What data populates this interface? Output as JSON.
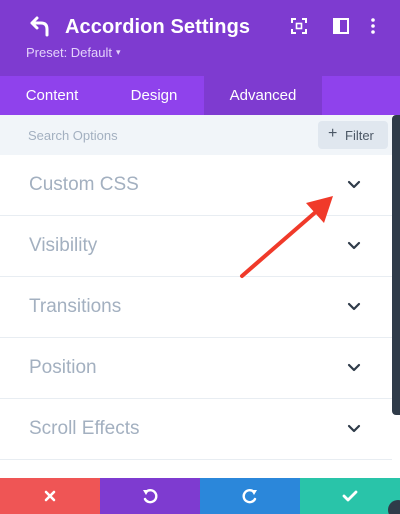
{
  "header": {
    "title": "Accordion Settings",
    "preset_label": "Preset: Default",
    "preset_caret": "▾",
    "icons": [
      "back-icon",
      "expand-icon",
      "sidebar-toggle-icon",
      "more-options-icon"
    ]
  },
  "tabs": [
    {
      "label": "Content",
      "active": false
    },
    {
      "label": "Design",
      "active": false
    },
    {
      "label": "Advanced",
      "active": true
    }
  ],
  "search": {
    "placeholder": "Search Options",
    "value": "",
    "filter_label": "Filter",
    "filter_icon": "plus-icon"
  },
  "sections": [
    {
      "label": "Custom CSS",
      "icon": "chevron-down-icon"
    },
    {
      "label": "Visibility",
      "icon": "chevron-down-icon"
    },
    {
      "label": "Transitions",
      "icon": "chevron-down-icon"
    },
    {
      "label": "Position",
      "icon": "chevron-down-icon"
    },
    {
      "label": "Scroll Effects",
      "icon": "chevron-down-icon"
    }
  ],
  "annotation": {
    "icon": "red-arrow",
    "color": "#f03a2a"
  },
  "footer": {
    "buttons": [
      {
        "icon": "close-icon",
        "color": "#ef5555"
      },
      {
        "icon": "undo-icon",
        "color": "#7e3bd0"
      },
      {
        "icon": "redo-icon",
        "color": "#2b87da"
      },
      {
        "icon": "check-icon",
        "color": "#29c4a9"
      }
    ]
  },
  "colors": {
    "header_bg": "#7e3bd0",
    "tabs_bg": "#8f42ec",
    "active_tab_bg": "#7e3bd0",
    "search_bg": "#f1f5f9",
    "label_text": "#a3b0c0"
  }
}
